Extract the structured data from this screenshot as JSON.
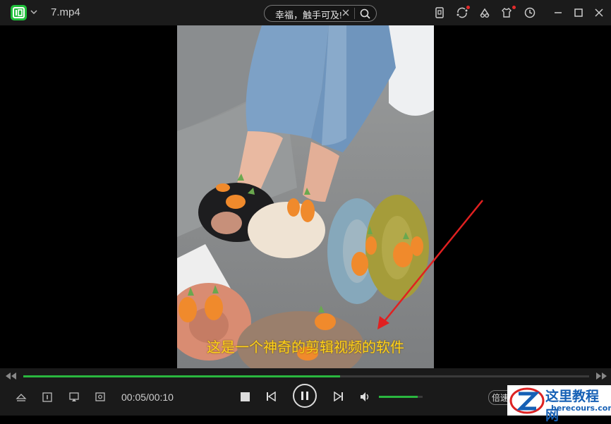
{
  "titlebar": {
    "app_logo_icon": "iqiyi-logo-icon",
    "file_title": "7.mp4",
    "search": {
      "text": "幸福，触手可及!"
    },
    "icons": [
      "phone-icon",
      "sync-icon",
      "cloud-icon",
      "skin-icon",
      "history-icon"
    ],
    "window_controls": [
      "minimize-icon",
      "maximize-icon",
      "close-icon"
    ]
  },
  "video": {
    "subtitle": "这是一个神奇的剪辑视频的软件"
  },
  "controls": {
    "progress": 0.56,
    "time": "00:05/00:10",
    "volume": 0.88,
    "speed_label": "倍速"
  },
  "watermark": {
    "title": "这里教程网",
    "url": "herecours.com"
  },
  "colors": {
    "accent": "#2ab73f",
    "subtitle": "#ffd21a",
    "annotation_arrow": "#e02020"
  }
}
